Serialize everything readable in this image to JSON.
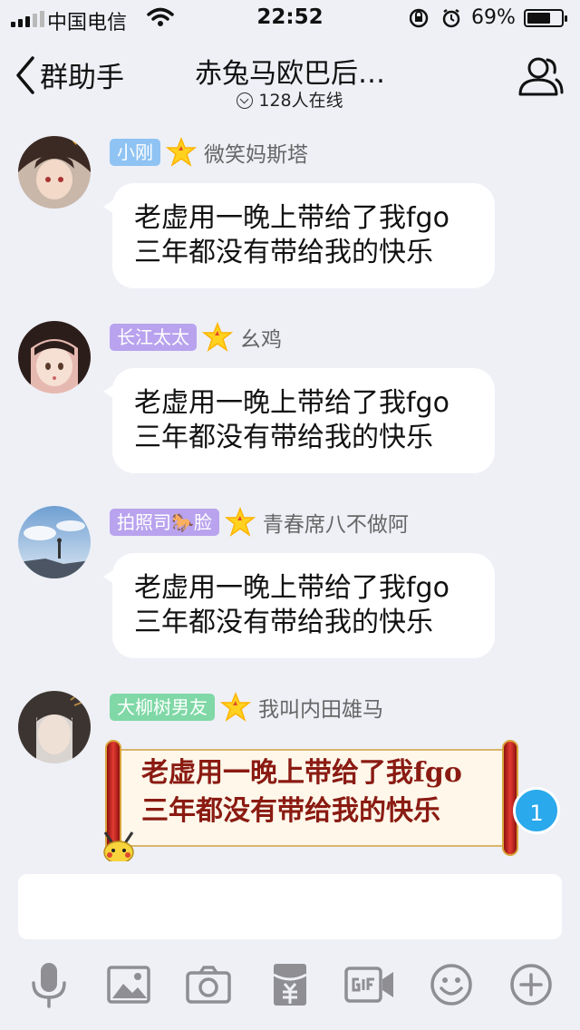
{
  "status_bar": {
    "carrier": "中国电信",
    "time": "22:52",
    "battery_percent": "69%",
    "battery_level": 0.69
  },
  "nav": {
    "back_label": "群助手",
    "title": "赤兔马欧巴后…",
    "online": "128人在线"
  },
  "messages": [
    {
      "tag": "小刚",
      "tag_color": "#8fc3f3",
      "sender": "微笑妈斯塔",
      "lines": [
        "老虚用一晚上带给了我fgo",
        "三年都没有带给我的快乐"
      ]
    },
    {
      "tag": "长江太太",
      "tag_color": "#b9a3ee",
      "sender": "幺鸡",
      "lines": [
        "老虚用一晚上带给了我fgo",
        "三年都没有带给我的快乐"
      ]
    },
    {
      "tag": "拍照司🐎脸",
      "tag_color": "#b9a3ee",
      "sender": "青春席八不做阿",
      "lines": [
        "老虚用一晚上带给了我fgo",
        "三年都没有带给我的快乐"
      ]
    },
    {
      "tag": "大柳树男友",
      "tag_color": "#7fd8a6",
      "sender": "我叫内田雄马",
      "lines": [
        "老虚用一晚上带给了我fgo",
        "三年都没有带给我的快乐"
      ]
    }
  ],
  "unread_count": "1",
  "input": {
    "value": "",
    "placeholder": ""
  },
  "toolbar_icons": [
    "microphone-icon",
    "image-icon",
    "camera-icon",
    "red-packet-icon",
    "gif-icon",
    "emoji-icon",
    "plus-icon"
  ]
}
